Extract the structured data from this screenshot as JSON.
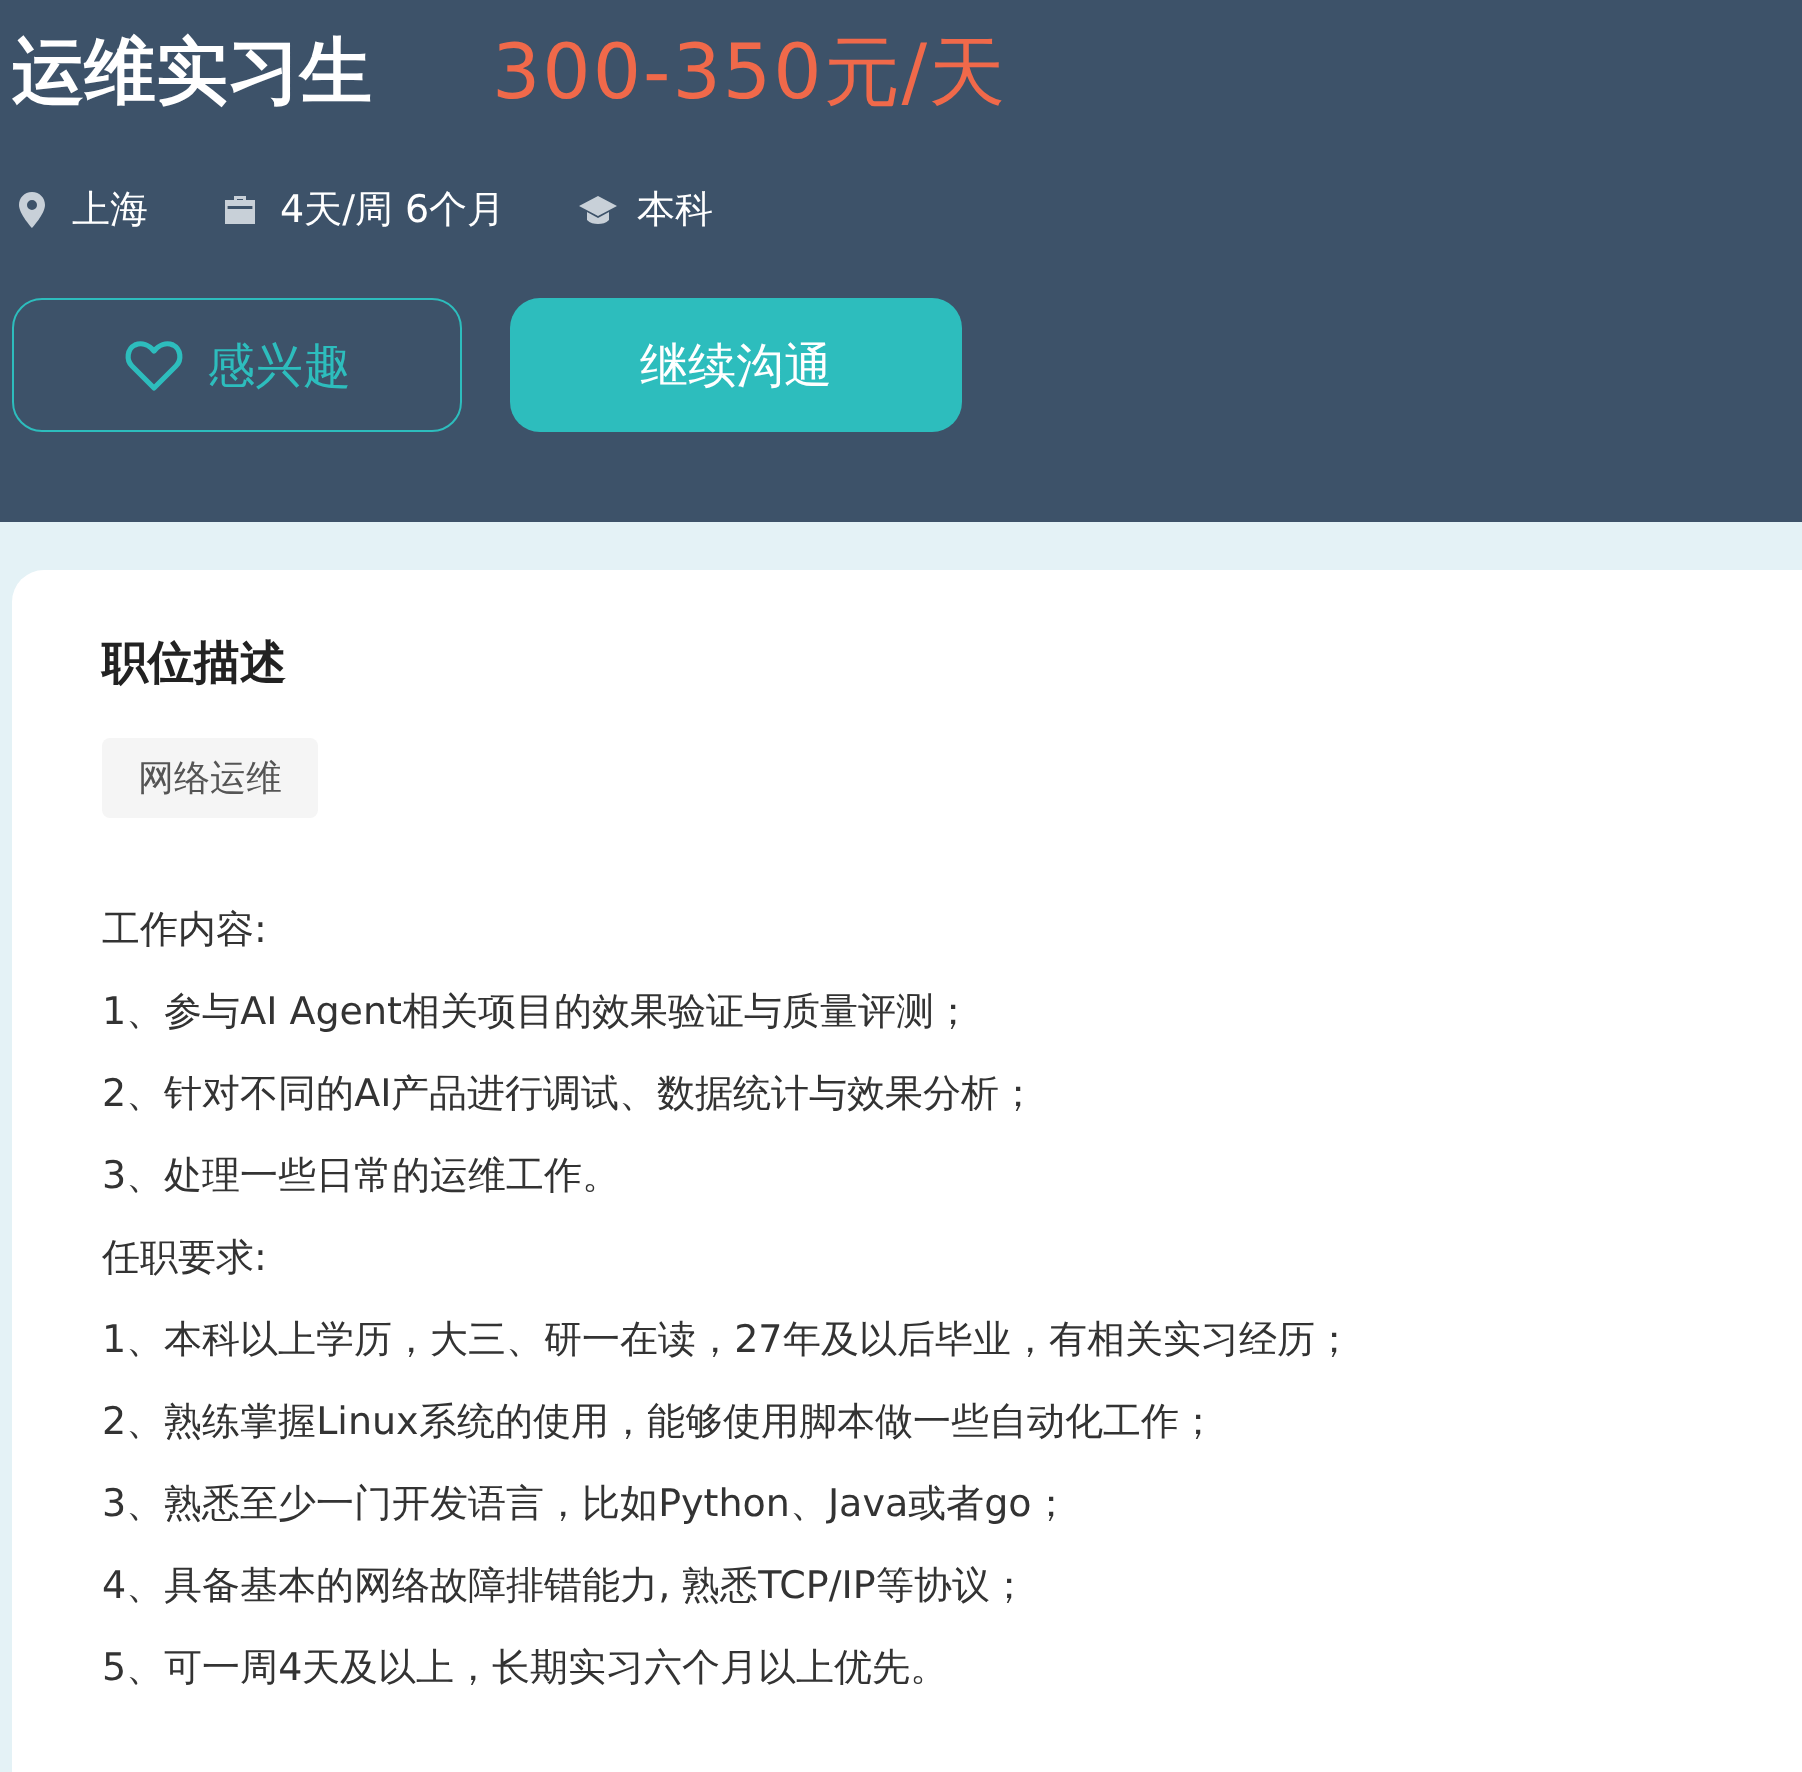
{
  "header": {
    "title": "运维实习生",
    "salary": "300-350元/天",
    "meta": [
      {
        "kind": "location",
        "text": "上海"
      },
      {
        "kind": "schedule",
        "text": "4天/周 6个月"
      },
      {
        "kind": "education",
        "text": "本科"
      }
    ],
    "buttons": [
      {
        "kind": "outline",
        "label": "感兴趣"
      },
      {
        "kind": "primary",
        "label": "继续沟通"
      }
    ]
  },
  "description": {
    "heading": "职位描述",
    "tags": [
      "网络运维"
    ],
    "lines": [
      "工作内容:",
      "1、参与AI Agent相关项目的效果验证与质量评测；",
      "2、针对不同的AI产品进行调试、数据统计与效果分析；",
      "3、处理一些日常的运维工作。",
      "任职要求:",
      "1、本科以上学历，大三、研一在读，27年及以后毕业，有相关实习经历；",
      "2、熟练掌握Linux系统的使用，能够使用脚本做一些自动化工作；",
      "3、熟悉至少一门开发语言，比如Python、Java或者go；",
      "4、具备基本的网络故障排错能力, 熟悉TCP/IP等协议；",
      "5、可一周4天及以上，长期实习六个月以上优先。"
    ]
  }
}
